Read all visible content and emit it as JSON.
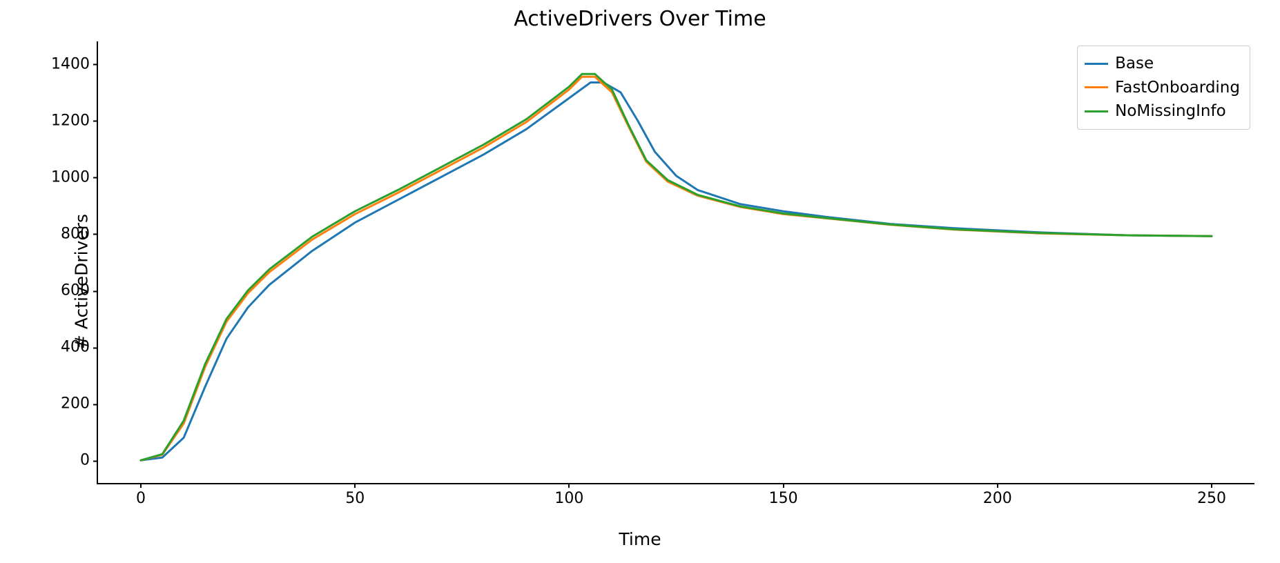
{
  "chart_data": {
    "type": "line",
    "title": "ActiveDrivers Over Time",
    "xlabel": "Time",
    "ylabel": "# ActiveDrivers",
    "xlim": [
      -10,
      260
    ],
    "ylim": [
      -80,
      1480
    ],
    "xticks": [
      0,
      50,
      100,
      150,
      200,
      250
    ],
    "yticks": [
      0,
      200,
      400,
      600,
      800,
      1000,
      1200,
      1400
    ],
    "series": [
      {
        "name": "Base",
        "color": "#1f77b4",
        "x": [
          0,
          5,
          10,
          15,
          20,
          25,
          30,
          40,
          50,
          60,
          70,
          80,
          90,
          100,
          105,
          108,
          112,
          116,
          120,
          125,
          130,
          140,
          150,
          160,
          175,
          190,
          210,
          230,
          250
        ],
        "values": [
          0,
          10,
          80,
          260,
          430,
          540,
          620,
          740,
          840,
          920,
          1000,
          1080,
          1170,
          1280,
          1335,
          1335,
          1300,
          1200,
          1090,
          1005,
          955,
          905,
          880,
          860,
          835,
          820,
          805,
          795,
          792
        ]
      },
      {
        "name": "FastOnboarding",
        "color": "#ff7f0e",
        "x": [
          0,
          5,
          10,
          15,
          20,
          25,
          30,
          40,
          50,
          60,
          70,
          80,
          90,
          100,
          103,
          106,
          110,
          114,
          118,
          123,
          130,
          140,
          150,
          160,
          175,
          190,
          210,
          230,
          250
        ],
        "values": [
          0,
          20,
          130,
          330,
          490,
          590,
          665,
          780,
          870,
          945,
          1025,
          1105,
          1195,
          1310,
          1355,
          1355,
          1300,
          1175,
          1055,
          985,
          935,
          895,
          870,
          855,
          832,
          815,
          802,
          795,
          792
        ]
      },
      {
        "name": "NoMissingInfo",
        "color": "#2ca02c",
        "x": [
          0,
          5,
          10,
          15,
          20,
          25,
          30,
          40,
          50,
          60,
          70,
          80,
          90,
          100,
          103,
          106,
          110,
          114,
          118,
          123,
          130,
          140,
          150,
          160,
          175,
          190,
          210,
          230,
          250
        ],
        "values": [
          0,
          22,
          140,
          340,
          500,
          600,
          675,
          790,
          880,
          955,
          1035,
          1115,
          1205,
          1320,
          1365,
          1365,
          1310,
          1180,
          1060,
          990,
          938,
          897,
          872,
          856,
          833,
          816,
          803,
          795,
          792
        ]
      }
    ]
  }
}
